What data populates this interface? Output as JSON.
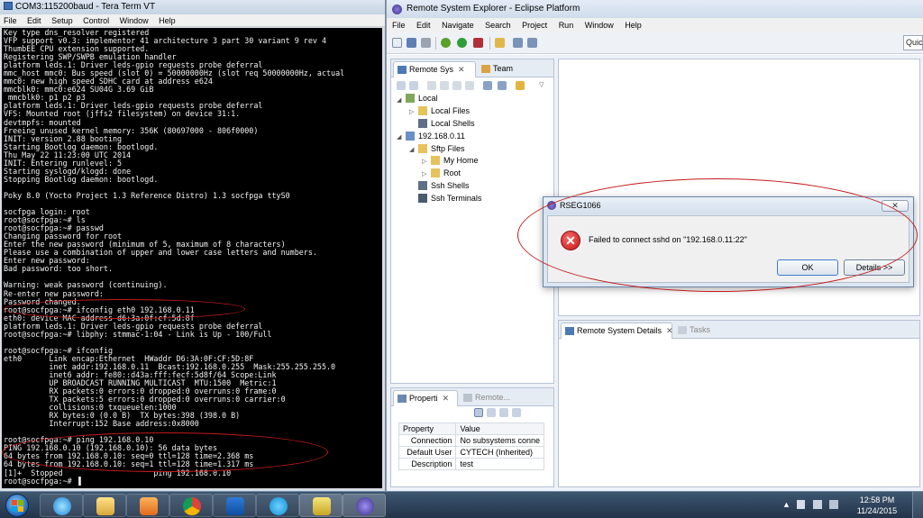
{
  "teraterm": {
    "title": "COM3:115200baud - Tera Term VT",
    "menu": [
      "File",
      "Edit",
      "Setup",
      "Control",
      "Window",
      "Help"
    ],
    "lines": [
      "Key type dns_resolver registered",
      "VFP support v0.3: implementor 41 architecture 3 part 30 variant 9 rev 4",
      "ThumbEE CPU extension supported.",
      "Registering SWP/SWPB emulation handler",
      "platform leds.1: Driver leds-gpio requests probe deferral",
      "mmc_host mmc0: Bus speed (slot 0) = 50000000Hz (slot req 50000000Hz, actual",
      "mmc0: new high speed SDHC card at address e624",
      "mmcblk0: mmc0:e624 SU04G 3.69 GiB",
      " mmcblk0: p1 p2 p3",
      "platform leds.1: Driver leds-gpio requests probe deferral",
      "VFS: Mounted root (jffs2 filesystem) on device 31:1.",
      "devtmpfs: mounted",
      "Freeing unused kernel memory: 356K (80697000 - 806f0000)",
      "INIT: version 2.88 booting",
      "Starting Bootlog daemon: bootlogd.",
      "Thu May 22 11:23:00 UTC 2014",
      "INIT: Entering runlevel: 5",
      "Starting syslogd/klogd: done",
      "Stopping Bootlog daemon: bootlogd.",
      "",
      "Poky 8.0 (Yocto Project 1.3 Reference Distro) 1.3 socfpga ttyS0",
      "",
      "socfpga login: root",
      "root@socfpga:~# ls",
      "root@socfpga:~# passwd",
      "Changing password for root",
      "Enter the new password (minimum of 5, maximum of 8 characters)",
      "Please use a combination of upper and lower case letters and numbers.",
      "Enter new password:",
      "Bad password: too short.",
      "",
      "Warning: weak password (continuing).",
      "Re-enter new password:",
      "Password changed.",
      "root@socfpga:~# ifconfig eth0 192.168.0.11",
      "eth0: device MAC address d6:3a:0f:cf:5d:8f",
      "platform leds.1: Driver leds-gpio requests probe deferral",
      "root@socfpga:~# libphy: stmmac-1:04 - Link is Up - 100/Full",
      "",
      "root@socfpga:~# ifconfig",
      "eth0      Link encap:Ethernet  HWaddr D6:3A:0F:CF:5D:8F",
      "          inet addr:192.168.0.11  Bcast:192.168.0.255  Mask:255.255.255.0",
      "          inet6 addr: fe80::d43a:fff:fecf:5d8f/64 Scope:Link",
      "          UP BROADCAST RUNNING MULTICAST  MTU:1500  Metric:1",
      "          RX packets:0 errors:0 dropped:0 overruns:0 frame:0",
      "          TX packets:5 errors:0 dropped:0 overruns:0 carrier:0",
      "          collisions:0 txqueuelen:1000",
      "          RX bytes:0 (0.0 B)  TX bytes:398 (398.0 B)",
      "          Interrupt:152 Base address:0x8000",
      "",
      "root@socfpga:~# ping 192.168.0.10",
      "PING 192.168.0.10 (192.168.0.10): 56 data bytes",
      "64 bytes from 192.168.0.10: seq=0 ttl=128 time=2.368 ms",
      "64 bytes from 192.168.0.10: seq=1 ttl=128 time=1.317 ms",
      "[1]+  Stopped                    ping 192.168.0.10",
      "root@socfpga:~# ▐"
    ]
  },
  "eclipse": {
    "title": "Remote System Explorer - Eclipse Platform",
    "menu": [
      "File",
      "Edit",
      "Navigate",
      "Search",
      "Project",
      "Run",
      "Window",
      "Help"
    ],
    "quick_access": "Quic",
    "rs_tab": "Remote Sys",
    "team_tab": "Team",
    "tree": {
      "local": "Local",
      "local_files": "Local Files",
      "local_shells": "Local Shells",
      "host": "192.168.0.11",
      "sftp_files": "Sftp Files",
      "my_home": "My Home",
      "root": "Root",
      "ssh_shells": "Ssh Shells",
      "ssh_terminals": "Ssh Terminals"
    },
    "details_tab": "Remote System Details",
    "tasks_tab": "Tasks",
    "props_tab": "Properti",
    "remote_tab": "Remote...",
    "props": {
      "headers": [
        "Property",
        "Value"
      ],
      "rows": [
        [
          "Connection",
          "No subsystems conne"
        ],
        [
          "Default User",
          "CYTECH (Inherited)"
        ],
        [
          "Description",
          "test"
        ]
      ]
    }
  },
  "dialog": {
    "title": "RSEG1066",
    "message": "Failed to connect sshd on \"192.168.0.11:22\"",
    "ok": "OK",
    "details": "Details >>"
  },
  "taskbar": {
    "time": "12:58 PM",
    "date": "11/24/2015"
  },
  "icons": {
    "error": "error-icon",
    "start": "windows-start-icon",
    "folder": "folder-icon",
    "computer": "computer-icon"
  },
  "colors": {
    "annotation": "#c41a1a",
    "terminal_bg": "#000000",
    "eclipse_accent": "#3b2f8a"
  }
}
